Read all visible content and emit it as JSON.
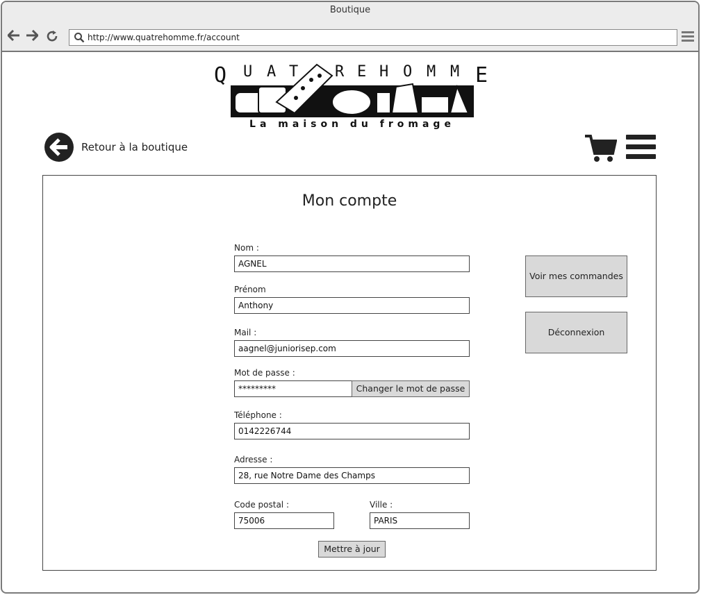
{
  "browser": {
    "title": "Boutique",
    "url": "http://www.quatrehomme.fr/account"
  },
  "logo": {
    "letters": [
      "Q",
      "U",
      "A",
      "T",
      "R",
      "E",
      "H",
      "O",
      "M",
      "M",
      "E"
    ],
    "tagline": "La maison du fromage"
  },
  "header": {
    "back_label": "Retour à la boutique"
  },
  "panel": {
    "title": "Mon compte"
  },
  "form": {
    "nom_label": "Nom :",
    "nom_value": "AGNEL",
    "prenom_label": "Prénom",
    "prenom_value": "Anthony",
    "mail_label": "Mail :",
    "mail_value": "aagnel@juniorisep.com",
    "password_label": "Mot de passe :",
    "password_value": "*********",
    "change_password_button": "Changer le mot de passe",
    "telephone_label": "Téléphone :",
    "telephone_value": "0142226744",
    "adresse_label": "Adresse :",
    "adresse_value": "28, rue Notre Dame des Champs",
    "code_postal_label": "Code postal :",
    "code_postal_value": "75006",
    "ville_label": "Ville :",
    "ville_value": "PARIS",
    "update_button": "Mettre à jour"
  },
  "side_actions": {
    "orders_button": "Voir mes commandes",
    "logout_button": "Déconnexion"
  },
  "icons": {
    "back": "arrow-left-circle-icon",
    "cart": "cart-icon",
    "menu": "hamburger-menu-icon",
    "search": "search-icon",
    "browser_back": "arrow-left-icon",
    "browser_forward": "arrow-right-icon",
    "reload": "reload-icon"
  }
}
